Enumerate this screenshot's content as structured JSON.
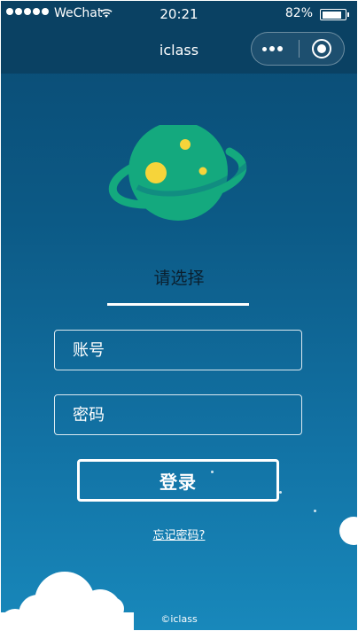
{
  "status_bar": {
    "carrier": "WeChat",
    "time": "20:21",
    "battery_percent": "82%",
    "battery_level": 0.82
  },
  "nav_bar": {
    "title": "iclass"
  },
  "login": {
    "subtitle": "请选择",
    "account_placeholder": "账号",
    "password_placeholder": "密码",
    "login_label": "登录",
    "forgot_password": "忘记密码?"
  },
  "footer": {
    "copyright": "©iclass"
  },
  "colors": {
    "background_top": "#0a4a72",
    "background_bottom": "#1888bb",
    "planet": "#14a97e",
    "planet_dots": "#f6d43a"
  },
  "icons": [
    "signal-icon",
    "wifi-icon",
    "battery-icon",
    "more-icon",
    "close-capsule-icon",
    "planet-logo-icon"
  ]
}
